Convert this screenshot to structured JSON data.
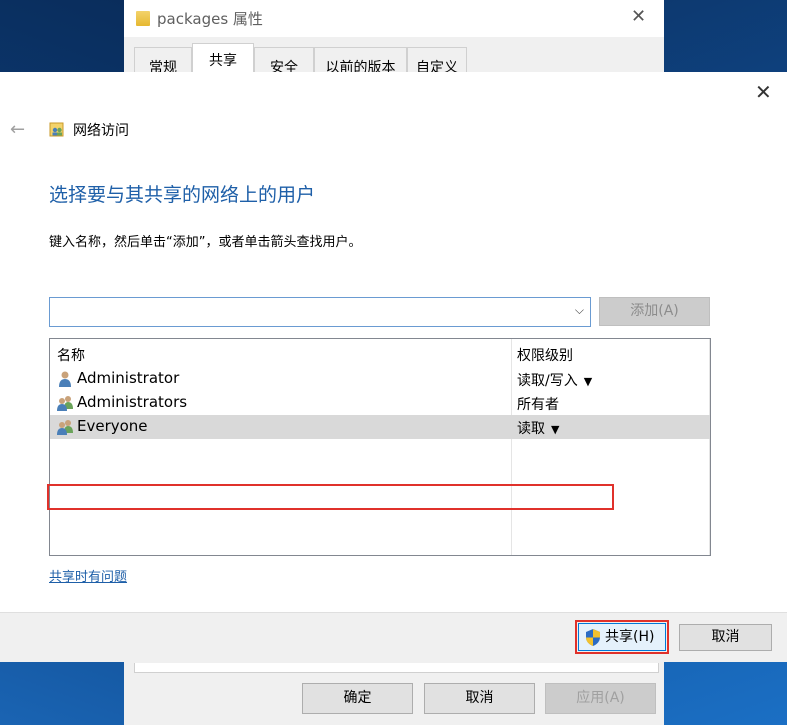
{
  "props_window": {
    "title": "packages 属性",
    "tabs": [
      "常规",
      "共享",
      "安全",
      "以前的版本",
      "自定义"
    ],
    "active_tab": "共享",
    "buttons": {
      "ok": "确定",
      "cancel": "取消",
      "apply": "应用(A)"
    }
  },
  "dialog": {
    "wizard_title": "网络访问",
    "heading": "选择要与其共享的网络上的用户",
    "instruction": "键入名称，然后单击“添加”，或者单击箭头查找用户。",
    "combo_value": "",
    "add_button": "添加(A)",
    "list": {
      "col_name": "名称",
      "col_perm": "权限级别",
      "rows": [
        {
          "name": "Administrator",
          "perm": "读取/写入",
          "dropdown": true,
          "icon": "single-user-icon"
        },
        {
          "name": "Administrators",
          "perm": "所有者",
          "dropdown": false,
          "icon": "user-group-icon"
        },
        {
          "name": "Everyone",
          "perm": "读取",
          "dropdown": true,
          "icon": "user-group-icon",
          "selected": true
        }
      ]
    },
    "help_link": "共享时有问题",
    "share_button": "共享(H)",
    "cancel_button": "取消"
  },
  "colors": {
    "heading": "#1e5fa8",
    "highlight": "#e0312b",
    "accent": "#0078d7"
  }
}
